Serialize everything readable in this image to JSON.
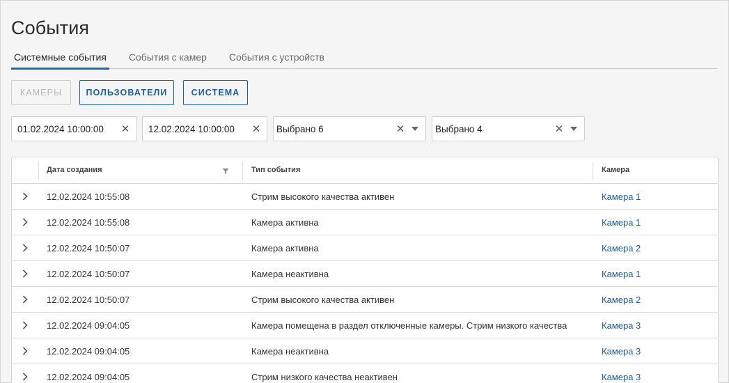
{
  "page": {
    "title": "События"
  },
  "tabs": [
    {
      "label": "Системные события",
      "active": true
    },
    {
      "label": "События с камер",
      "active": false
    },
    {
      "label": "События с устройств",
      "active": false
    }
  ],
  "filter_buttons": {
    "cameras": "Камеры",
    "users": "Пользователи",
    "system": "Система"
  },
  "filters": {
    "date_from": "01.02.2024 10:00:00",
    "date_to": "12.02.2024 10:00:00",
    "select1": "Выбрано 6",
    "select2": "Выбрано 4"
  },
  "table": {
    "columns": {
      "date": "Дата создания",
      "type": "Тип события",
      "camera": "Камера"
    },
    "rows": [
      {
        "date": "12.02.2024 10:55:08",
        "type": "Стрим высокого качества активен",
        "camera": "Камера 1"
      },
      {
        "date": "12.02.2024 10:55:08",
        "type": "Камера активна",
        "camera": "Камера 1"
      },
      {
        "date": "12.02.2024 10:50:07",
        "type": "Камера активна",
        "camera": "Камера 2"
      },
      {
        "date": "12.02.2024 10:50:07",
        "type": "Камера неактивна",
        "camera": "Камера 1"
      },
      {
        "date": "12.02.2024 10:50:07",
        "type": "Стрим высокого качества активен",
        "camera": "Камера 2"
      },
      {
        "date": "12.02.2024 09:04:05",
        "type": "Камера помещена в раздел отключенные камеры. Стрим низкого качества",
        "camera": "Камера 3"
      },
      {
        "date": "12.02.2024 09:04:05",
        "type": "Камера неактивна",
        "camera": "Камера 3"
      },
      {
        "date": "12.02.2024 09:04:05",
        "type": "Стрим низкого качества неактивен",
        "camera": "Камера 3"
      }
    ]
  },
  "colors": {
    "accent": "#1e5fa3",
    "tab_underline": "#1e6ab4"
  }
}
